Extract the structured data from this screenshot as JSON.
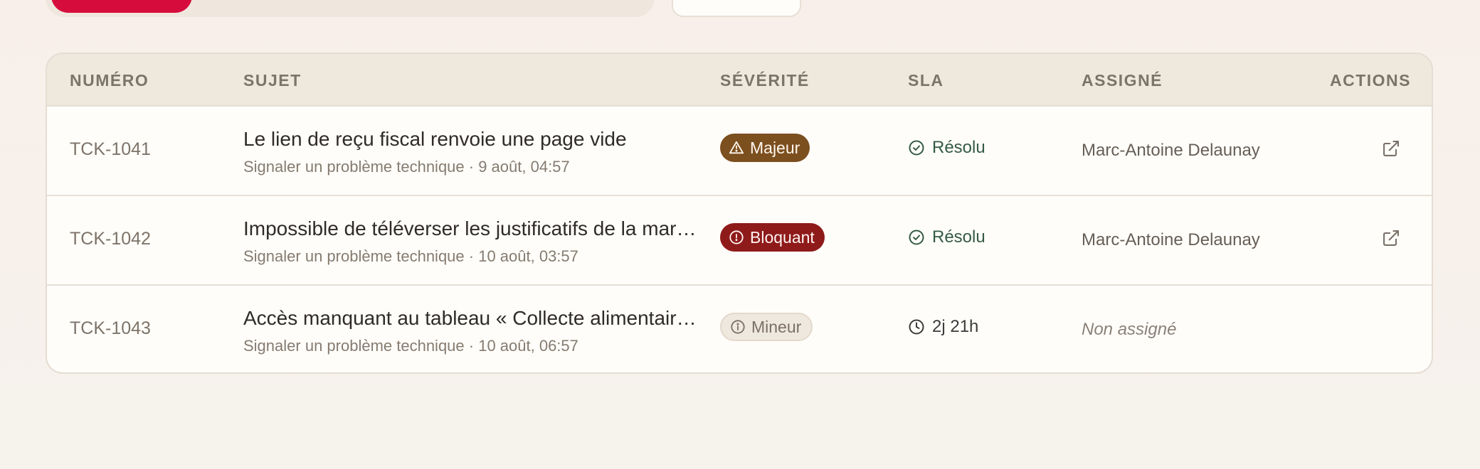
{
  "table": {
    "headers": {
      "number": "NUMÉRO",
      "subject": "SUJET",
      "severity": "SÉVÉRITÉ",
      "sla": "SLA",
      "assignee": "ASSIGNÉ",
      "actions": "ACTIONS"
    },
    "rows": [
      {
        "id": "TCK-1041",
        "title": "Le lien de reçu fiscal renvoie une page vide",
        "meta": "Signaler un problème technique · 9 août, 04:57",
        "severity": "Majeur",
        "severity_icon": "warning-triangle-icon",
        "sla": "Résolu",
        "sla_icon": "check-circle-icon",
        "assignee": "Marc-Antoine Delaunay"
      },
      {
        "id": "TCK-1042",
        "title": "Impossible de téléverser les justificatifs de la mar…",
        "meta": "Signaler un problème technique · 10 août, 03:57",
        "severity": "Bloquant",
        "severity_icon": "alert-circle-icon",
        "sla": "Résolu",
        "sla_icon": "check-circle-icon",
        "assignee": "Marc-Antoine Delaunay"
      },
      {
        "id": "TCK-1043",
        "title": "Accès manquant au tableau « Collecte alimentaire…",
        "meta": "Signaler un problème technique · 10 août, 06:57",
        "severity": "Mineur",
        "severity_icon": "info-circle-icon",
        "sla": "2j 21h",
        "sla_icon": "clock-icon",
        "assignee": "Non assigné"
      }
    ]
  },
  "colors": {
    "accent": "#d60d3c",
    "majeur": "#7c4f1f",
    "bloquant": "#8e1a1a",
    "mineur_bg": "#efe8de",
    "sla_resolved": "#345a44"
  }
}
